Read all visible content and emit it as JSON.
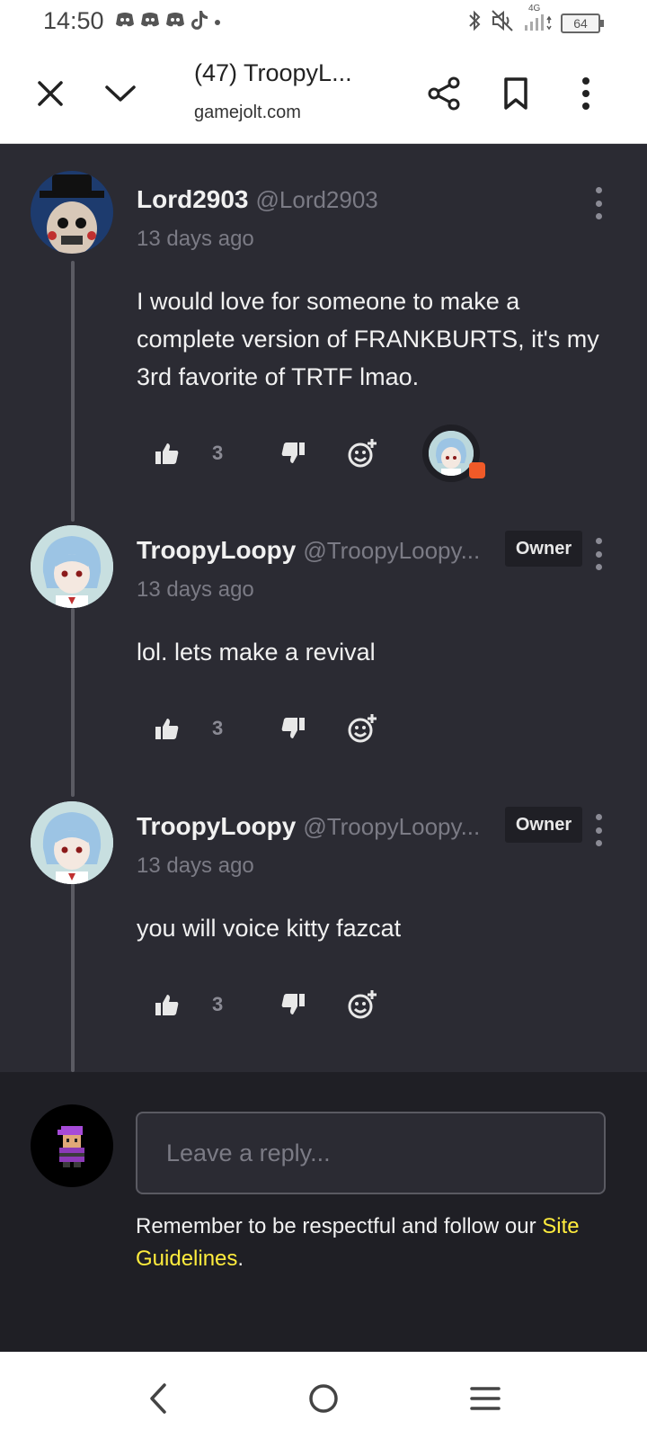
{
  "status_bar": {
    "time": "14:50",
    "network": "4G",
    "battery": "64",
    "icons": [
      "discord-icon",
      "discord-icon",
      "discord-icon",
      "tiktok-icon",
      "bluetooth-icon",
      "mute-icon",
      "signal-icon",
      "battery-icon"
    ]
  },
  "browser": {
    "tab_title": "(47) TroopyL...",
    "domain": "gamejolt.com",
    "icons": [
      "close-icon",
      "chevron-down-icon",
      "share-icon",
      "bookmark-icon",
      "more-vertical-icon"
    ]
  },
  "comments": [
    {
      "author": "Lord2903",
      "handle": "@Lord2903",
      "time": "13 days ago",
      "badge": "",
      "text": "I would love for someone to make a complete version of FRANKBURTS, it's my 3rd favorite of TRTF lmao.",
      "likes": "3",
      "has_owner_reply": true
    },
    {
      "author": "TroopyLoopy",
      "handle": "@TroopyLoopy...",
      "time": "13 days ago",
      "badge": "Owner",
      "text": "lol. lets make a revival",
      "likes": "3",
      "has_owner_reply": false
    },
    {
      "author": "TroopyLoopy",
      "handle": "@TroopyLoopy...",
      "time": "13 days ago",
      "badge": "Owner",
      "text": "you will voice kitty fazcat",
      "likes": "3",
      "has_owner_reply": false
    }
  ],
  "reply": {
    "placeholder": "Leave a reply...",
    "notice": "Remember to be respectful and follow our ",
    "link": "Site Guidelines",
    "notice_end": "."
  },
  "colors": {
    "background": "#2b2b33",
    "reply_area": "#1f1f25",
    "link": "#ffec3d",
    "muted": "#7b7b85"
  }
}
